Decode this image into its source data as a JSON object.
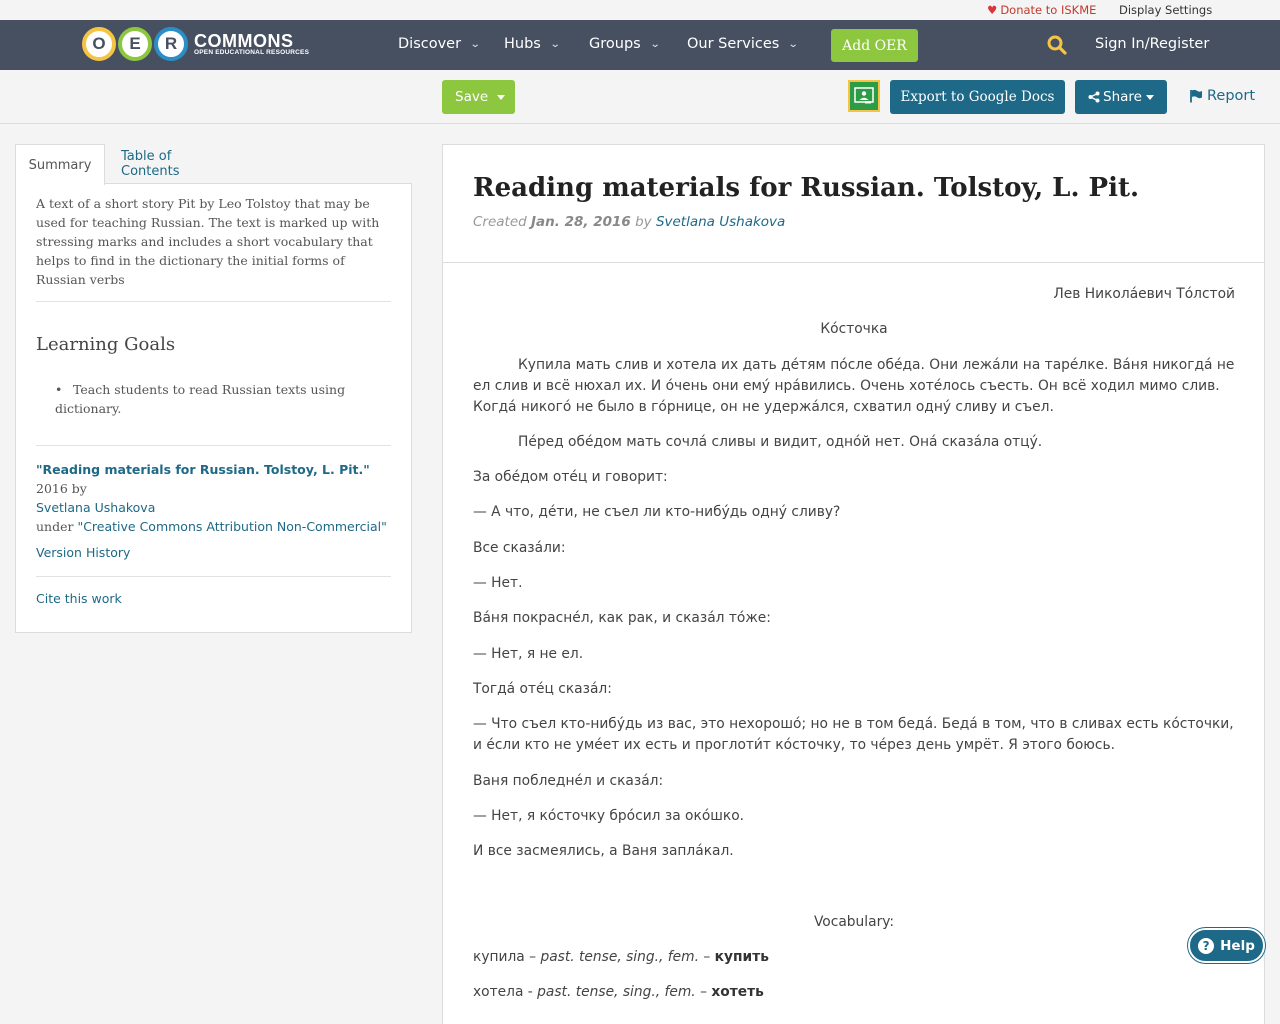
{
  "utility": {
    "donate": "Donate to ISKME",
    "display_settings": "Display Settings"
  },
  "navbar": {
    "logo_letters": [
      "O",
      "E",
      "R"
    ],
    "logo_word": "COMMONS",
    "logo_sub": "OPEN EDUCATIONAL RESOURCES",
    "items": [
      {
        "label": "Discover"
      },
      {
        "label": "Hubs"
      },
      {
        "label": "Groups"
      },
      {
        "label": "Our Services"
      }
    ],
    "add_oer": "Add OER",
    "sign_in": "Sign In/Register"
  },
  "toolbar": {
    "save": "Save",
    "export": "Export to Google Docs",
    "share": "Share",
    "report": "Report"
  },
  "sidebar": {
    "tabs": {
      "summary": "Summary",
      "toc": "Table of Contents"
    },
    "summary_text": "A text of a short story Pit by Leo Tolstoy that may be used for teaching Russian. The text is marked up with stressing marks and includes a short vocabulary that helps to find in the dictionary the initial forms of Russian verbs",
    "learning_goals_title": "Learning Goals",
    "learning_goals": [
      "Teach students to read Russian texts using dictionary."
    ],
    "attribution": {
      "title": "\"Reading materials for Russian. Tolstoy, L. Pit.\"",
      "year_by": " 2016 by",
      "author": "Svetlana Ushakova",
      "under": "under ",
      "license": "\"Creative Commons Attribution Non-Commercial\""
    },
    "version_history": "Version History",
    "cite": "Cite this work"
  },
  "main": {
    "title": "Reading materials for Russian. Tolstoy, L. Pit.",
    "created_label": "Created ",
    "created_date": "Jan. 28, 2016",
    "by": " by ",
    "author": "Svetlana Ushakova",
    "author_line": "Лев Никола́евич То́лстой",
    "story_title": "Ко́сточка",
    "paragraphs": [
      "Купила мать слив и хотела их дать де́тям по́сле обе́да. Они лежа́ли на таре́лке. Ва́ня никогда́ не ел слив и всё нюхал их. И о́чень они ему́ нра́вились. Очень хоте́лось съесть. Он всё ходил мимо слив. Когда́ никого́ не было в го́рнице, он не удержа́лся, схватил одну́ сливу и съел.",
      "Пе́ред обе́дом мать сочла́ сливы и видит, одно́й нет. Она́ сказа́ла отцу́.",
      "За обе́дом оте́ц и говорит:",
      "— А что, де́ти, не съел ли кто-нибу́дь одну́ сливу?",
      "Все сказа́ли:",
      "— Нет.",
      "Ва́ня покрасне́л, как рак, и сказа́л то́же:",
      "— Нет, я не ел.",
      "Тогда́ оте́ц сказа́л:",
      "— Что съел кто-нибу́дь из вас, это нехорошо́; но не в том беда́. Беда́ в том, что в сливах есть ко́сточки, и е́сли кто не уме́ет их есть и проглоти́т ко́сточку, то че́рез день умрёт. Я этого боюсь.",
      "Ваня побледне́л и сказа́л:",
      "— Нет, я ко́сточку бро́сил за око́шко.",
      "И все засмеялись, а Ваня запла́кал."
    ],
    "vocabulary_title": "Vocabulary:",
    "vocabulary": [
      {
        "word": "купила",
        "sep": " – ",
        "gram": "past. tense, sing., fem.",
        "sep2": " – ",
        "base": "купить"
      },
      {
        "word": "хотела",
        "sep": " - ",
        "gram": "past. tense, sing., fem.",
        "sep2": " – ",
        "base": "хотеть"
      }
    ]
  },
  "help": "Help",
  "colors": {
    "navbar": "#475061",
    "green": "#8dc63f",
    "blue": "#1e6987",
    "donate": "#c0392b"
  }
}
